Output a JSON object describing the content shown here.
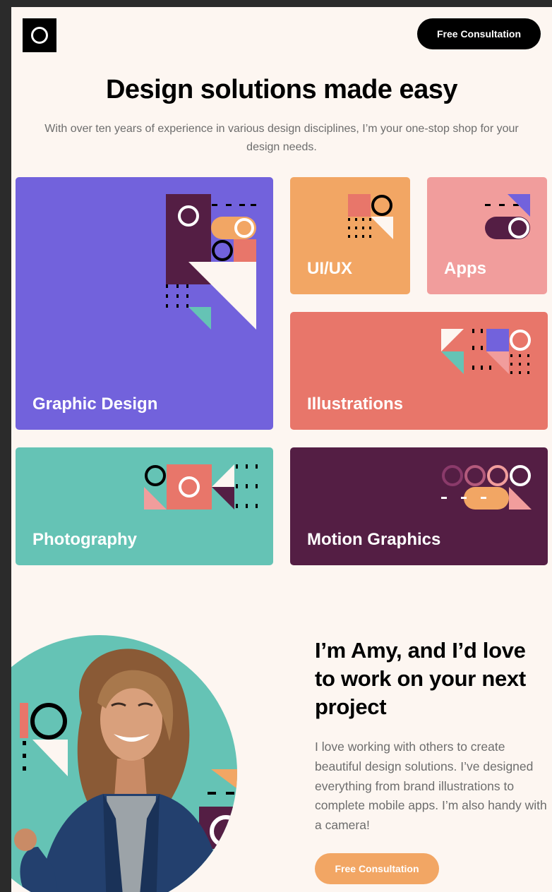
{
  "header": {
    "logo_icon": "ring-logo-icon",
    "cta_label": "Free Consultation"
  },
  "hero": {
    "title": "Design solutions made easy",
    "subtitle": "With over ten years of experience in various design disciplines, I’m your one-stop shop for your design needs."
  },
  "services": [
    {
      "label": "Graphic Design",
      "color": "#7262dc"
    },
    {
      "label": "UI/UX",
      "color": "#f2a664"
    },
    {
      "label": "Apps",
      "color": "#f19d9c"
    },
    {
      "label": "Illustrations",
      "color": "#e8766a"
    },
    {
      "label": "Photography",
      "color": "#65c3b5"
    },
    {
      "label": "Motion Graphics",
      "color": "#541e44"
    }
  ],
  "about": {
    "title": "I’m Amy, and I’d love to work on your next project",
    "text": "I love working with others to create beautiful design solutions. I’ve designed everything from brand illustrations to complete mobile apps. I’m also handy with a camera!",
    "cta_label": "Free Consultation",
    "photo_icon": "portrait-photo"
  },
  "colors": {
    "background": "#fdf6f1",
    "purple": "#7262dc",
    "orange": "#f2a664",
    "pink": "#f19d9c",
    "red": "#e8766a",
    "teal": "#65c3b5",
    "plum": "#541e44"
  }
}
